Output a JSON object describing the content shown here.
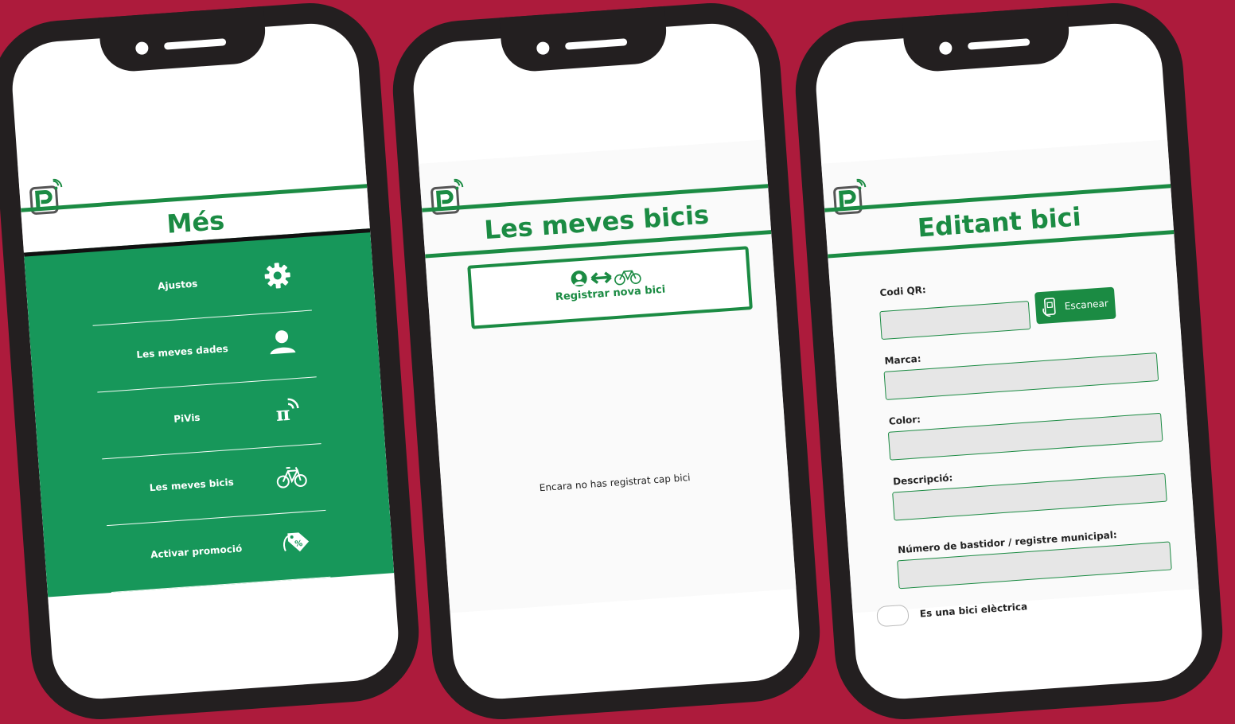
{
  "screens": {
    "mes": {
      "title": "Més",
      "menu": [
        {
          "label": "Ajustos",
          "icon": "gear-icon"
        },
        {
          "label": "Les meves dades",
          "icon": "user-icon"
        },
        {
          "label": "PiVis",
          "icon": "pi-signal-icon"
        },
        {
          "label": "Les meves bicis",
          "icon": "bicycle-icon"
        },
        {
          "label": "Activar promoció",
          "icon": "tag-percent-icon"
        }
      ]
    },
    "bicis": {
      "title": "Les meves bicis",
      "register_label": "Registrar nova bici",
      "empty_message": "Encara no has registrat cap bici"
    },
    "editant": {
      "title": "Editant bici",
      "qr_label": "Codi QR:",
      "scan_label": "Escanear",
      "brand_label": "Marca:",
      "color_label": "Color:",
      "description_label": "Descripció:",
      "frame_label": "Número de bastidor / registre municipal:",
      "electric_label": "Es una bici elèctrica"
    }
  },
  "colors": {
    "background": "#ad1b3c",
    "brand_green": "#1b8b43",
    "menu_green": "#17975a",
    "phone": "#231f20"
  }
}
